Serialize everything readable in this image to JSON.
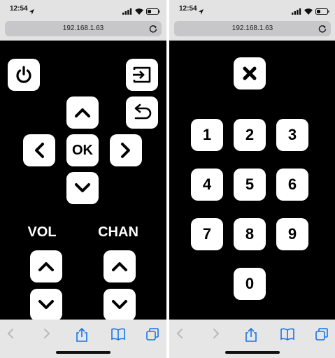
{
  "left": {
    "status": {
      "time": "12:54"
    },
    "address": {
      "url": "192.168.1.63"
    },
    "remote": {
      "ok_label": "OK",
      "vol_label": "VOL",
      "chan_label": "CHAN"
    }
  },
  "right": {
    "status": {
      "time": "12:54"
    },
    "address": {
      "url": "192.168.1.63"
    },
    "keypad": {
      "keys": [
        "1",
        "2",
        "3",
        "4",
        "5",
        "6",
        "7",
        "8",
        "9",
        "0"
      ]
    }
  },
  "colors": {
    "background": "#000000",
    "button": "#ffffff",
    "toolbar_icon_active": "#1a73e8",
    "toolbar_icon_disabled": "#b9b9b9"
  },
  "icons": [
    "power-icon",
    "input-icon",
    "back-icon",
    "chevron-up-icon",
    "chevron-down-icon",
    "chevron-left-icon",
    "chevron-right-icon",
    "close-icon",
    "share-icon",
    "bookmarks-icon",
    "tabs-icon",
    "reload-icon"
  ]
}
